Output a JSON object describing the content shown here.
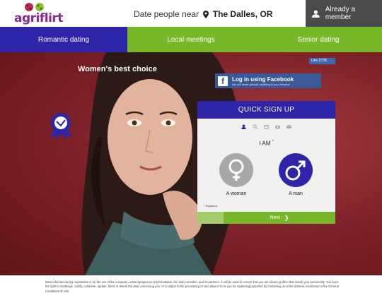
{
  "header": {
    "logo_text": "agriflirt",
    "near_prefix": "Date people near",
    "city": "The Dalles, OR",
    "member_button": "Already a member"
  },
  "nav": {
    "items": [
      {
        "label": "Romantic dating"
      },
      {
        "label": "Local meetings"
      },
      {
        "label": "Senior dating"
      }
    ]
  },
  "hero": {
    "badge": "Women's best choice",
    "fb_like": "Like 272K",
    "fb_login": "Log in using Facebook",
    "fb_note": "We will never publish anything to your timeline"
  },
  "signup": {
    "title": "QUICK SIGN UP",
    "question": "I AM",
    "required_mark": "*",
    "options": [
      {
        "label": "A woman",
        "icon": "female-symbol-icon"
      },
      {
        "label": "A man",
        "icon": "male-symbol-icon"
      }
    ],
    "required_note": "* Required",
    "next": "Next"
  },
  "legal": {
    "text": "Data collected during registration is for the use of the company La Bourguignonne d'Informatique, the data controller, and its partners. It will be used to ensure that you are shown profiles that match your personality. You have the right to challenge, rectify, complete, update, block or delete the data concerning you, or to object to the processing of said data or to its use for marketing purposes by contacting us at the address mentioned in the General Conditions of Use."
  },
  "colors": {
    "primary": "#2e24a8",
    "accent_green": "#79b72a",
    "dark": "#4a4a4a",
    "facebook": "#3b5998",
    "background_red": "#7a1f26"
  }
}
